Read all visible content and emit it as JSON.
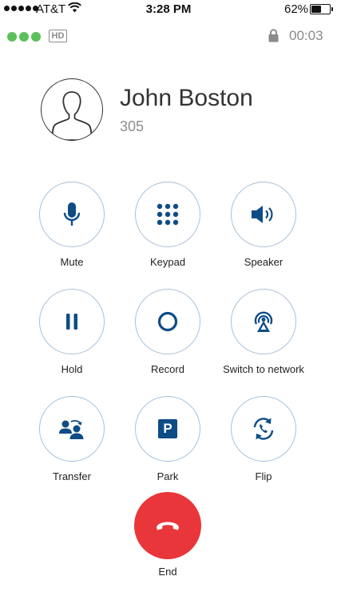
{
  "status_bar": {
    "carrier": "AT&T",
    "time": "3:28 PM",
    "battery_percent": "62%",
    "battery_level": 0.62
  },
  "call_info": {
    "hd_label": "HD",
    "duration": "00:03",
    "quality_indicator_color": "#5cc05c"
  },
  "contact": {
    "name": "John Boston",
    "number": "305"
  },
  "actions": {
    "mute": "Mute",
    "keypad": "Keypad",
    "speaker": "Speaker",
    "hold": "Hold",
    "record": "Record",
    "switch_network": "Switch to network",
    "transfer": "Transfer",
    "park": "Park",
    "park_glyph": "P",
    "flip": "Flip"
  },
  "end_call": {
    "label": "End",
    "color": "#e8363b"
  },
  "theme": {
    "icon_color": "#0e4c86",
    "ring_color": "#a8c2da"
  }
}
